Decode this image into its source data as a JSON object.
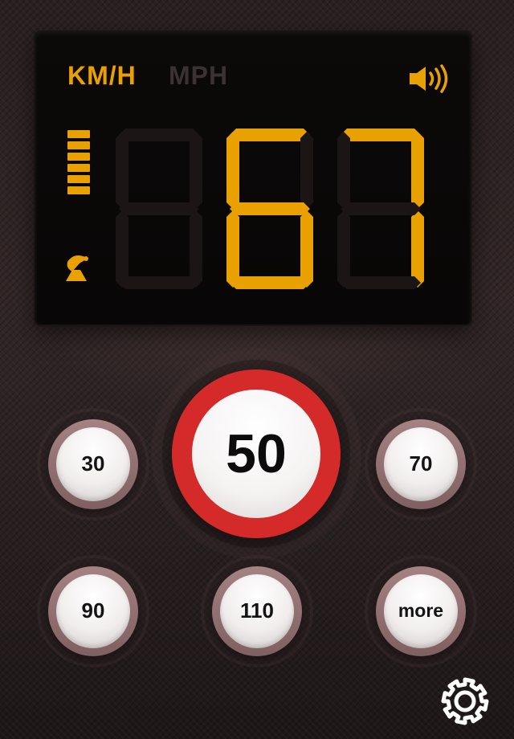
{
  "display": {
    "unit_active": "KM/H",
    "unit_inactive": "MPH",
    "speed": "67",
    "signal_level": 6,
    "signal_max": 6,
    "accent_color": "#e9a100",
    "icons": {
      "sound": "speaker-icon",
      "gps": "satellite-dish-icon"
    }
  },
  "limits": {
    "selected": "50",
    "options": [
      "30",
      "70",
      "90",
      "110"
    ],
    "more_label": "more",
    "ring_color": "#d42a2a"
  },
  "settings": {
    "icon": "gear-icon"
  }
}
